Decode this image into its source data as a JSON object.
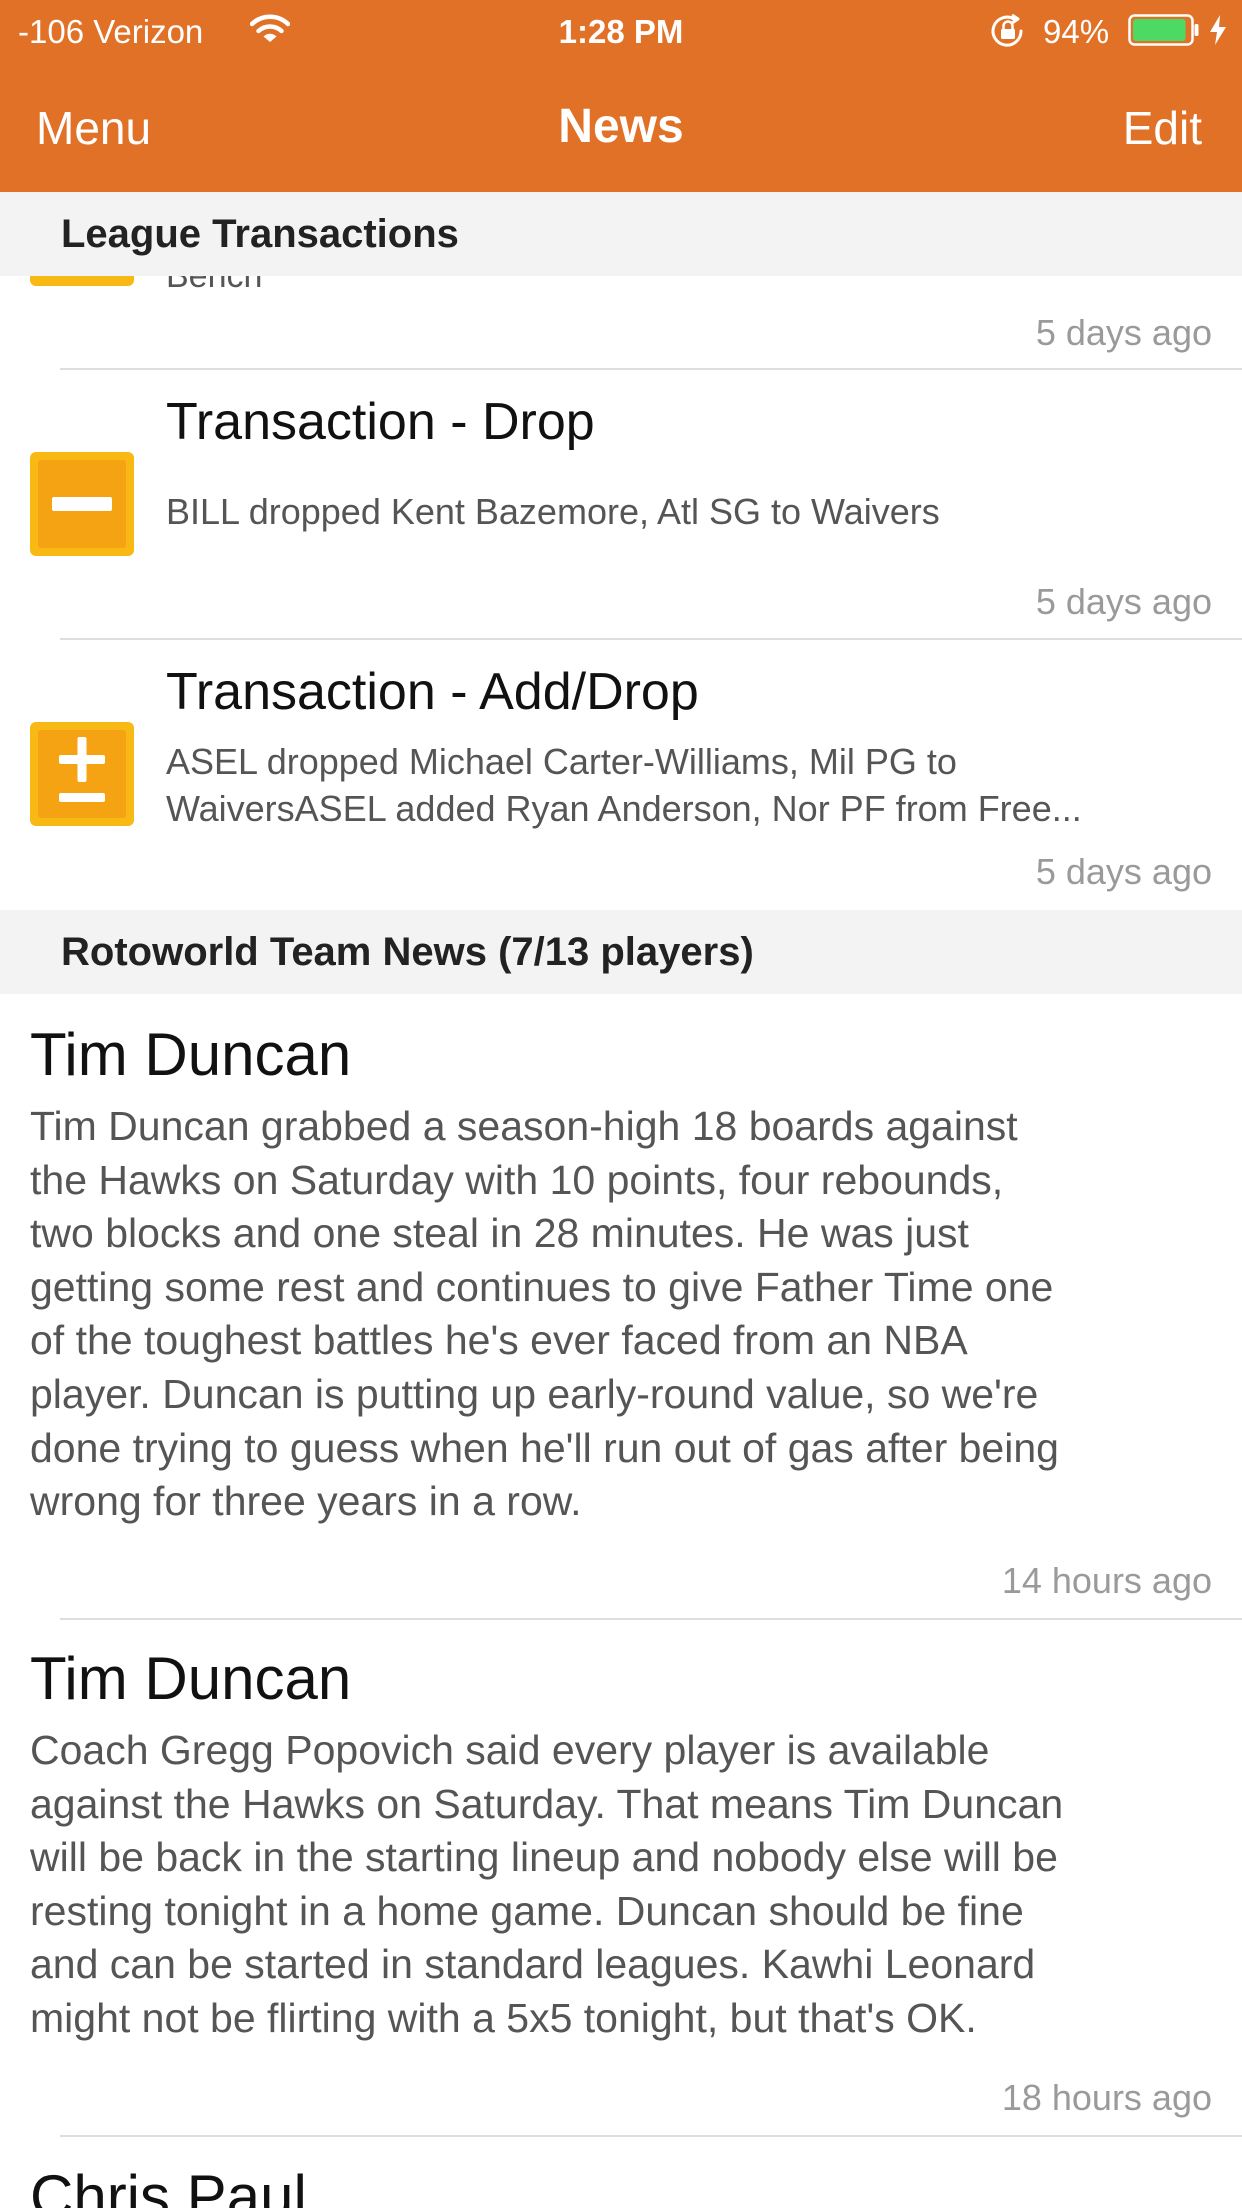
{
  "status_bar": {
    "carrier": "-106 Verizon",
    "time": "1:28 PM",
    "battery_percent": "94%",
    "battery_level": 0.94,
    "icons": [
      "wifi-icon",
      "orientation-lock-icon",
      "battery-icon",
      "charging-bolt-icon"
    ]
  },
  "nav": {
    "left_label": "Menu",
    "title": "News",
    "right_label": "Edit",
    "bar_color": "#e07126"
  },
  "league_transactions": {
    "header": "League Transactions",
    "partial_item": {
      "text": "Bench",
      "time": "5 days ago"
    },
    "items": [
      {
        "icon": "minus-icon",
        "title": "Transaction - Drop",
        "description": "BILL dropped Kent Bazemore, Atl SG to Waivers",
        "time": "5 days ago"
      },
      {
        "icon": "plus-minus-icon",
        "title": "Transaction - Add/Drop",
        "description_line1": "ASEL dropped Michael Carter-Williams, Mil PG to",
        "description_line2": "WaiversASEL added Ryan Anderson, Nor PF from Free...",
        "time": "5 days ago"
      }
    ],
    "icon_color": "#f9b914"
  },
  "team_news": {
    "header": "Rotoworld Team News (7/13 players)",
    "items": [
      {
        "player": "Tim Duncan",
        "lines": [
          "Tim Duncan grabbed a season-high 18 boards against",
          "the Hawks on Saturday with 10 points, four rebounds,",
          "two blocks and one steal in 28 minutes. He was just",
          "getting some rest and continues to give Father Time one",
          "of the toughest battles he's ever faced from an NBA",
          "player. Duncan is putting up early-round value, so we're",
          "done trying to guess when he'll run out of gas after being",
          "wrong for three years in a row."
        ],
        "time": "14 hours ago"
      },
      {
        "player": "Tim Duncan",
        "lines": [
          "Coach Gregg Popovich said every player is available",
          "against the Hawks on Saturday. That means Tim Duncan",
          "will be back in the starting lineup and nobody else will be",
          "resting tonight in a home game. Duncan should be fine",
          "and can be started in standard leagues. Kawhi Leonard",
          "might not be flirting with a 5x5 tonight, but that's OK."
        ],
        "time": "18 hours ago"
      },
      {
        "player": "Chris Paul"
      }
    ]
  }
}
